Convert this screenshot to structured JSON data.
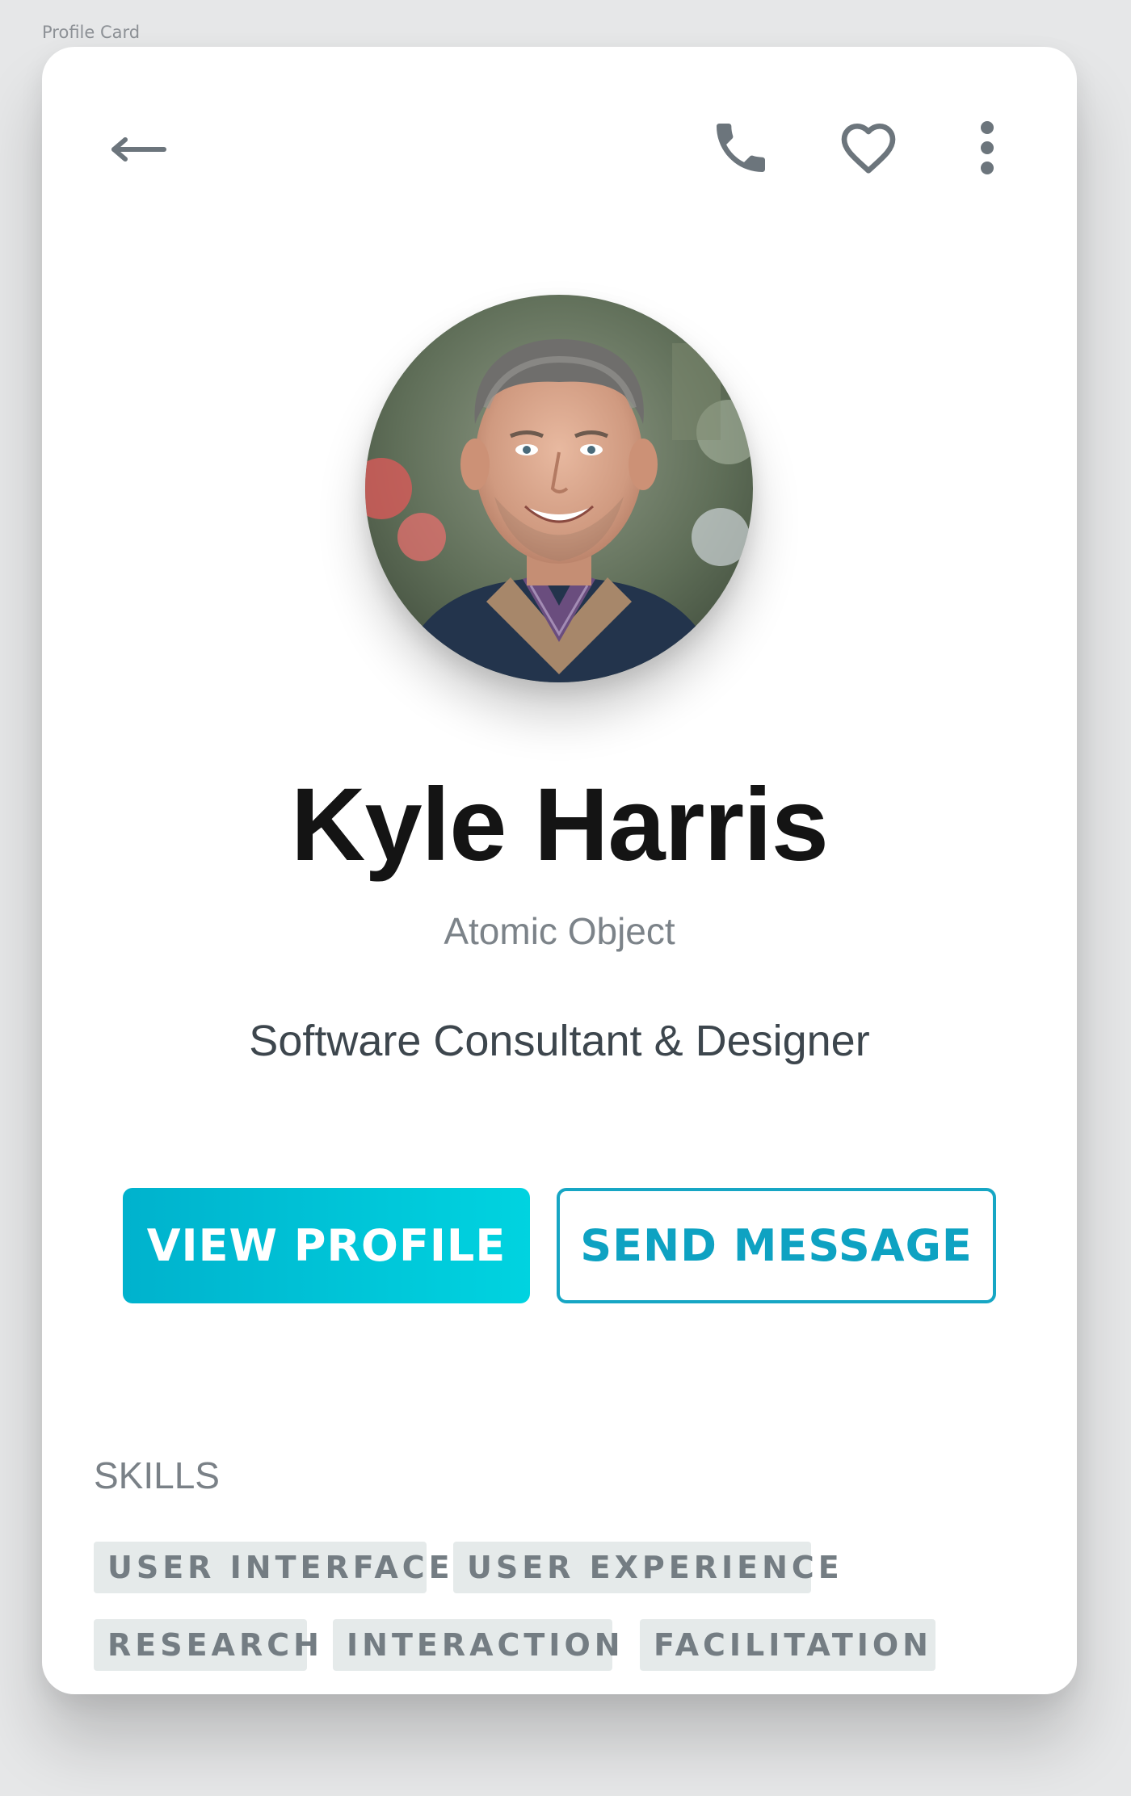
{
  "frame_label": "Profile Card",
  "topbar": {
    "back_icon": "arrow-left-icon",
    "call_icon": "phone-icon",
    "favorite_icon": "heart-outline-icon",
    "more_icon": "more-vertical-icon",
    "icon_color": "#6c757c"
  },
  "profile": {
    "name": "Kyle Harris",
    "company": "Atomic Object",
    "role": "Software Consultant & Designer",
    "avatar_icon": "profile-photo"
  },
  "actions": {
    "primary_label": "VIEW PROFILE",
    "secondary_label": "SEND MESSAGE",
    "accent_color": "#00bcd4"
  },
  "skills": {
    "heading": "SKILLS",
    "items": [
      "USER INTERFACE",
      "USER EXPERIENCE",
      "RESEARCH",
      "INTERACTION",
      "FACILITATION"
    ]
  }
}
